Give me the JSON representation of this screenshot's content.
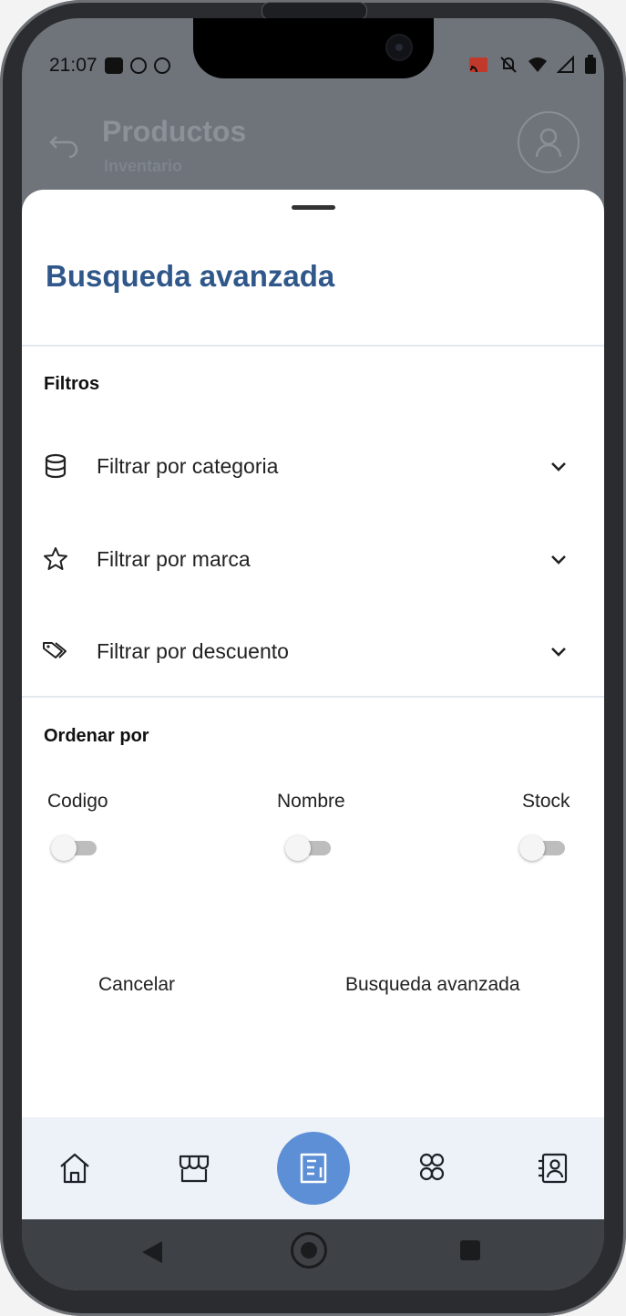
{
  "status_bar": {
    "time": "21:07"
  },
  "app_header": {
    "title": "Productos",
    "subtitle": "Inventario"
  },
  "sheet": {
    "title": "Busqueda avanzada",
    "filters_label": "Filtros",
    "filters": [
      {
        "icon": "database-icon",
        "label": "Filtrar por categoria"
      },
      {
        "icon": "star-icon",
        "label": "Filtrar por marca"
      },
      {
        "icon": "tags-icon",
        "label": "Filtrar por descuento"
      }
    ],
    "sort_label": "Ordenar por",
    "sort_options": [
      {
        "label": "Codigo",
        "enabled": false
      },
      {
        "label": "Nombre",
        "enabled": false
      },
      {
        "label": "Stock",
        "enabled": false
      }
    ],
    "cancel_label": "Cancelar",
    "search_label": "Busqueda avanzada"
  },
  "bottom_nav": {
    "items": [
      "home-icon",
      "store-icon",
      "catalog-icon",
      "groups-icon",
      "contacts-icon"
    ],
    "active": "catalog-icon"
  },
  "colors": {
    "title": "#2f578a",
    "active_nav": "#5d8fd6",
    "nav_bg": "#edf1f8"
  }
}
